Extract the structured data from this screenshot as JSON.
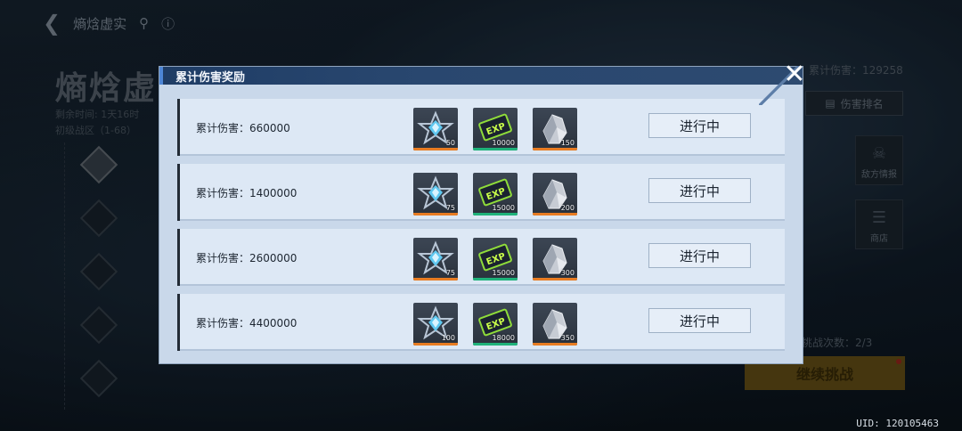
{
  "background": {
    "nav_title": "熵焓虚实",
    "page_title": "熵焓虚",
    "sub_line1": "剩余时间: 1天16时",
    "sub_line2": "初级战区（1-68）",
    "total_damage_label": "累计伤害：129258",
    "rank_button_label": "伤害排名",
    "enemy_intel_label": "敌方情报",
    "shop_label": "商店",
    "attempts_label": "挑战次数：2/3",
    "challenge_button_label": "继续挑战"
  },
  "modal": {
    "title": "累计伤害奖励",
    "close_icon": "close-icon",
    "rows": [
      {
        "label": "累计伤害：660000",
        "status": "进行中",
        "rewards": [
          {
            "icon": "star-crystal-icon",
            "qty": "50",
            "rarity_color": "#e87c22"
          },
          {
            "icon": "exp-card-icon",
            "qty": "10000",
            "rarity_color": "#1fb27a"
          },
          {
            "icon": "ore-crystal-icon",
            "qty": "150",
            "rarity_color": "#e87c22"
          }
        ]
      },
      {
        "label": "累计伤害：1400000",
        "status": "进行中",
        "rewards": [
          {
            "icon": "star-crystal-icon",
            "qty": "75",
            "rarity_color": "#e87c22"
          },
          {
            "icon": "exp-card-icon",
            "qty": "15000",
            "rarity_color": "#1fb27a"
          },
          {
            "icon": "ore-crystal-icon",
            "qty": "200",
            "rarity_color": "#e87c22"
          }
        ]
      },
      {
        "label": "累计伤害：2600000",
        "status": "进行中",
        "rewards": [
          {
            "icon": "star-crystal-icon",
            "qty": "75",
            "rarity_color": "#e87c22"
          },
          {
            "icon": "exp-card-icon",
            "qty": "15000",
            "rarity_color": "#1fb27a"
          },
          {
            "icon": "ore-crystal-icon",
            "qty": "300",
            "rarity_color": "#e87c22"
          }
        ]
      },
      {
        "label": "累计伤害：4400000",
        "status": "进行中",
        "rewards": [
          {
            "icon": "star-crystal-icon",
            "qty": "100",
            "rarity_color": "#e87c22"
          },
          {
            "icon": "exp-card-icon",
            "qty": "18000",
            "rarity_color": "#1fb27a"
          },
          {
            "icon": "ore-crystal-icon",
            "qty": "350",
            "rarity_color": "#e87c22"
          }
        ]
      }
    ]
  },
  "uid": "UID: 120105463"
}
